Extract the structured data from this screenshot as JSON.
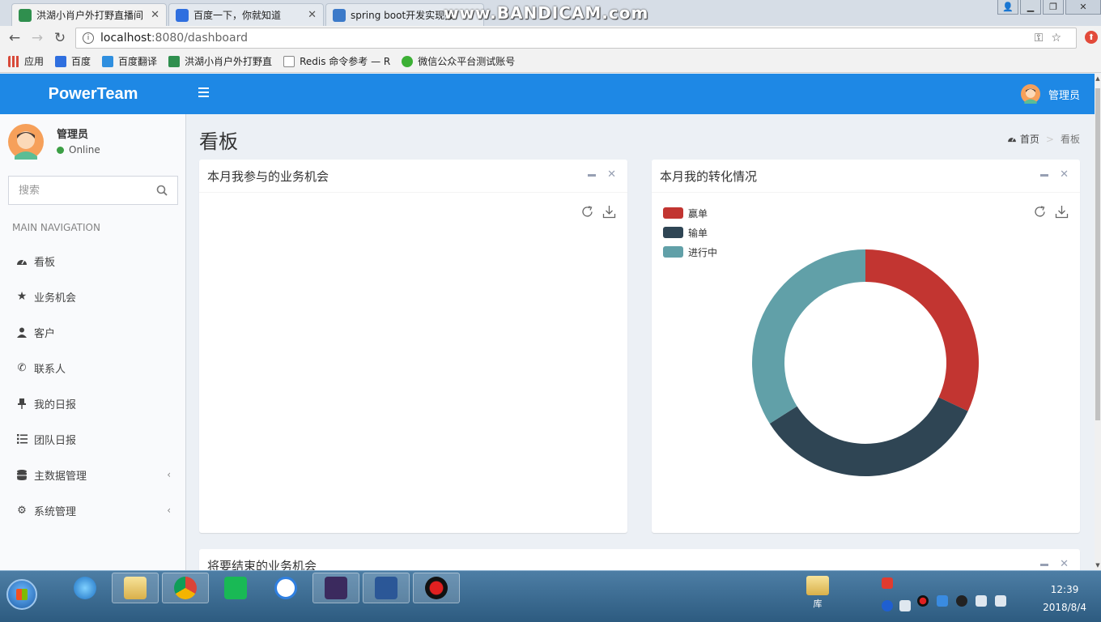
{
  "browser": {
    "tabs": [
      {
        "title": "洪湖小肖户外打野直播间",
        "icon_color": "#2f8f4e"
      },
      {
        "title": "百度一下，你就知道",
        "icon_color": "#2f6fdf"
      },
      {
        "title": "spring boot开发实现报",
        "icon_color": "#3c7ac9"
      }
    ],
    "watermark": "www.BANDICAM.com",
    "url_host": "localhost",
    "url_path": ":8080/dashboard",
    "bookmarks": [
      {
        "label": "应用",
        "icon_color": "#d84a3a"
      },
      {
        "label": "百度",
        "icon_color": "#2f6fdf"
      },
      {
        "label": "百度翻译",
        "icon_color": "#2f8fdf"
      },
      {
        "label": "洪湖小肖户外打野直",
        "icon_color": "#2f8f4e"
      },
      {
        "label": "Redis 命令参考 — R",
        "icon_color": "#999999"
      },
      {
        "label": "微信公众平台测试账号",
        "icon_color": "#3cb035"
      }
    ]
  },
  "app": {
    "brand": "PowerTeam",
    "header_user": "管理员",
    "accent": "#1e88e5",
    "sidebar": {
      "user_name": "管理员",
      "user_status": "Online",
      "search_placeholder": "搜索",
      "nav_header": "MAIN NAVIGATION",
      "items": [
        {
          "label": "看板",
          "icon": "dashboard-icon",
          "caret": ""
        },
        {
          "label": "业务机会",
          "icon": "star-icon",
          "caret": ""
        },
        {
          "label": "客户",
          "icon": "user-tie-icon",
          "caret": ""
        },
        {
          "label": "联系人",
          "icon": "phone-icon",
          "caret": ""
        },
        {
          "label": "我的日报",
          "icon": "pin-icon",
          "caret": ""
        },
        {
          "label": "团队日报",
          "icon": "list-icon",
          "caret": ""
        },
        {
          "label": "主数据管理",
          "icon": "database-icon",
          "caret": "‹"
        },
        {
          "label": "系统管理",
          "icon": "cogs-icon",
          "caret": "‹"
        }
      ]
    },
    "page_title": "看板",
    "breadcrumb": {
      "home": "首页",
      "separator": ">",
      "current": "看板"
    },
    "boxes": {
      "opportunities": {
        "title": "本月我参与的业务机会"
      },
      "conversion": {
        "title": "本月我的转化情况"
      },
      "ending": {
        "title": "将要结束的业务机会"
      }
    }
  },
  "chart_data": {
    "type": "pie",
    "title": "本月我的转化情况",
    "donut": true,
    "legend_position": "top-left",
    "series": [
      {
        "name": "赢单",
        "value": 32,
        "color": "#c23531"
      },
      {
        "name": "输单",
        "value": 34,
        "color": "#2f4554"
      },
      {
        "name": "进行中",
        "value": 34,
        "color": "#61a0a8"
      }
    ]
  },
  "taskbar": {
    "library_label": "库",
    "time": "12:39",
    "date": "2018/8/4"
  }
}
